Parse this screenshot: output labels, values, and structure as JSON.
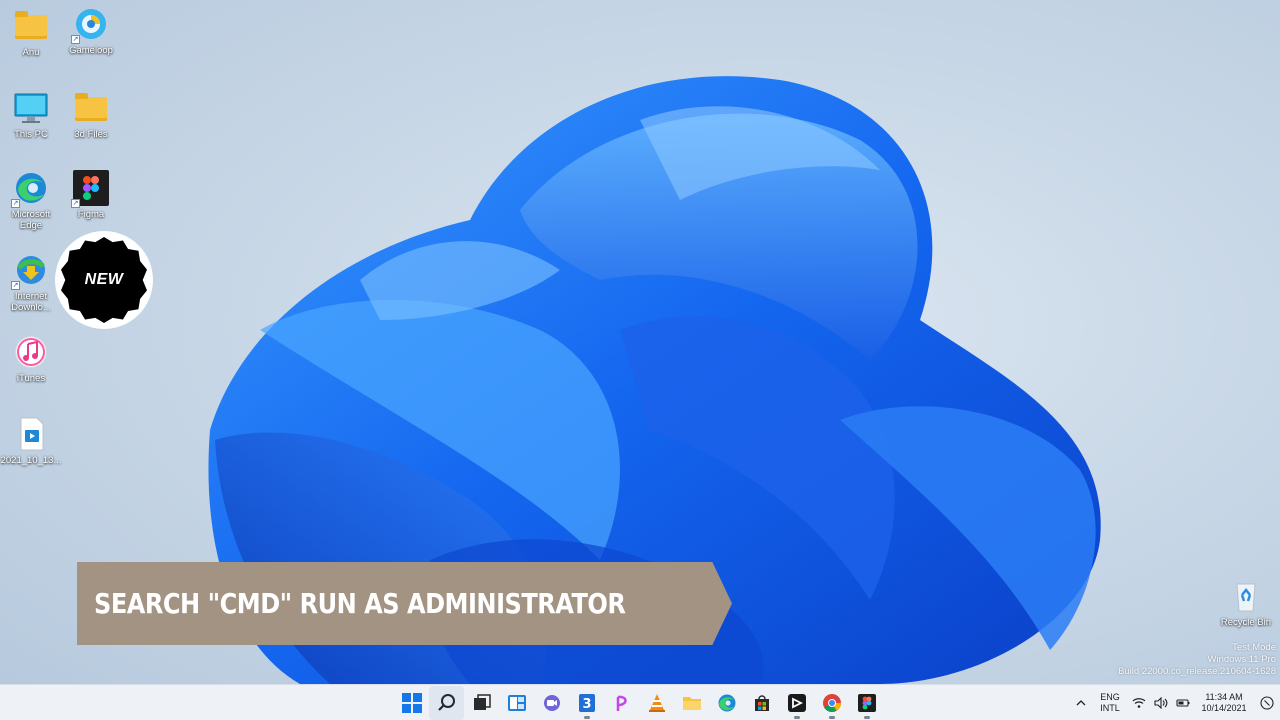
{
  "desktop": {
    "icons": [
      {
        "label": "Anu",
        "icon": "folder-icon"
      },
      {
        "label": "Gameloop",
        "icon": "gameloop-icon"
      },
      {
        "label": "This PC",
        "icon": "monitor-icon"
      },
      {
        "label": "3d Files",
        "icon": "folder-icon"
      },
      {
        "label": "Microsoft Edge",
        "icon": "edge-icon"
      },
      {
        "label": "Figma",
        "icon": "figma-icon"
      },
      {
        "label": "Internet Downlo...",
        "icon": "idm-icon"
      },
      {
        "label": "iTunes",
        "icon": "itunes-icon"
      },
      {
        "label": "2021_10_13...",
        "icon": "video-file-icon"
      },
      {
        "label": "Recycle Bin",
        "icon": "recycle-bin-icon"
      }
    ]
  },
  "overlay": {
    "badge_text": "NEW",
    "banner_text": "SEARCH \"CMD\" RUN AS ADMINISTRATOR",
    "banner_color": "#a29383"
  },
  "watermark": {
    "line1": "Test Mode",
    "line2": "Windows 11 Pro",
    "line3": "Build 22000.co_release.210604-1628"
  },
  "taskbar": {
    "apps": [
      "start-icon",
      "search-icon",
      "task-view-icon",
      "widgets-icon",
      "teams-chat-icon",
      "3-app-icon",
      "picsart-icon",
      "vlc-icon",
      "file-explorer-icon",
      "edge-icon",
      "store-icon",
      "capcut-icon",
      "chrome-icon",
      "figma-icon"
    ],
    "language_line1": "ENG",
    "language_line2": "INTL",
    "time": "11:34 AM",
    "date": "10/14/2021"
  }
}
